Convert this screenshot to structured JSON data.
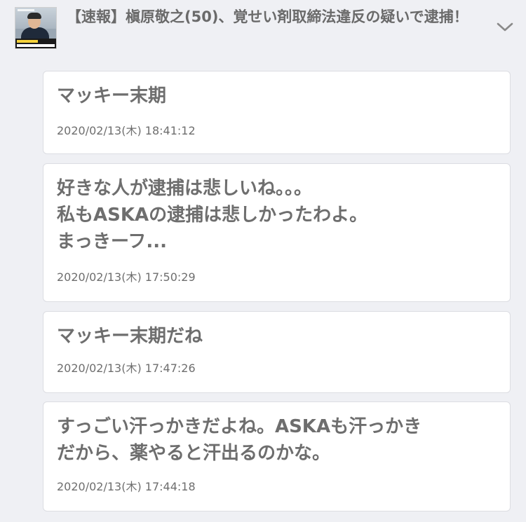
{
  "header": {
    "thumbnail_icon": "news-thumbnail-image",
    "title": "【速報】槇原敬之(50)、覚せい剤取締法違反の疑いで逮捕！",
    "expand_icon": "chevron-down-icon"
  },
  "comments": [
    {
      "body": "マッキー末期",
      "date": "2020/02/13(木) 18:41:12"
    },
    {
      "body": "好きな人が逮捕は悲しいね。。。\n私もASKAの逮捕は悲しかったわよ。\nまっきーフ...",
      "date": "2020/02/13(木) 17:50:29"
    },
    {
      "body": "マッキー末期だね",
      "date": "2020/02/13(木) 17:47:26"
    },
    {
      "body": "すっごい汗っかきだよね。ASKAも汗っかき\nだから、薬やると汗出るのかな。",
      "date": "2020/02/13(木) 17:44:18"
    }
  ]
}
